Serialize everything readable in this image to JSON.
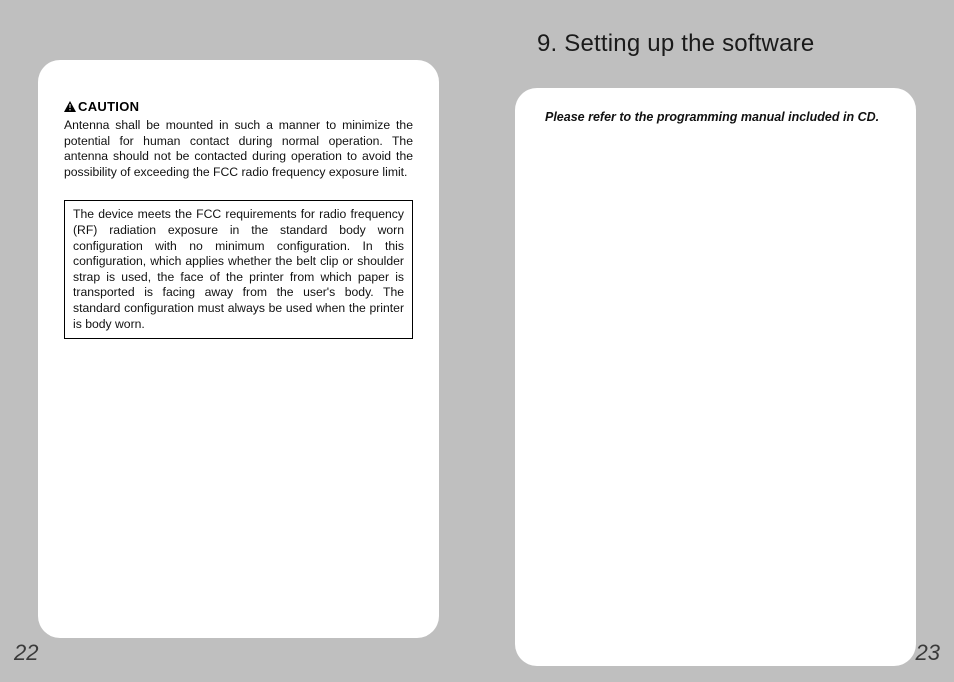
{
  "left": {
    "caution_label": "CAUTION",
    "caution_text": "Antenna shall be mounted in such a manner to minimize the potential for human contact during normal operation. The antenna should not be contacted during operation to avoid the possibility of exceeding the FCC radio frequency exposure limit.",
    "rf_text": "The device meets the FCC requirements for radio frequency (RF) radiation exposure in the standard body worn configuration with no minimum configuration. In this configuration, which applies whether the belt clip or shoulder strap is used, the face of the printer from which paper is transported is facing away from the user's body. The standard configuration must always be used when the printer is body worn.",
    "page_number": "22"
  },
  "right": {
    "heading": "9. Setting up the software",
    "note": "Please refer to the programming manual included in CD.",
    "page_number": "23"
  }
}
